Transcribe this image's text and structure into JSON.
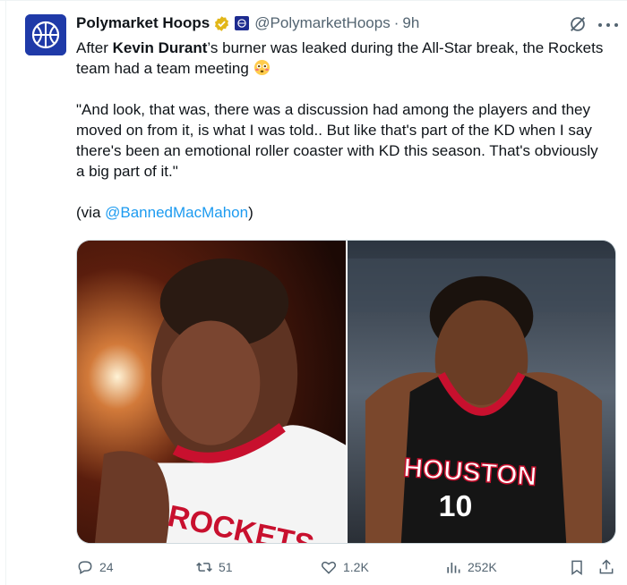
{
  "tweet": {
    "author_name": "Polymarket Hoops",
    "handle": "@PolymarketHoops",
    "separator": "·",
    "time": "9h",
    "text_line1_pre": "After ",
    "text_line1_bold": "Kevin Durant",
    "text_line1_post": "’s burner was leaked during the All-Star break, the Rockets team had a team meeting ",
    "emoji": "flushed-face-emoji",
    "quote": "\"And look, that was, there was a discussion had among the players and they moved on from it, is what I was told.. But like that's part of the KD when I say there's been an emotional roller coaster with KD this season. That's obviously a big part of it.\"",
    "via_pre": "(via ",
    "via_link": "@BannedMacMahon",
    "via_post": ")",
    "left_photo_jersey_text": "ROCKETS",
    "right_photo_jersey_text": "HOUSTON",
    "right_photo_number": "10"
  },
  "actions": {
    "replies": "24",
    "reposts": "51",
    "likes": "1.2K",
    "views": "252K"
  },
  "icons": [
    "verified-badge-icon",
    "affiliate-badge-icon",
    "grok-icon",
    "more-icon",
    "reply-icon",
    "repost-icon",
    "like-icon",
    "views-icon",
    "bookmark-icon",
    "share-icon"
  ],
  "colors": {
    "accent": "#1d9bf0",
    "muted": "#536471",
    "text": "#0f1419",
    "verified": "#e2b719"
  }
}
